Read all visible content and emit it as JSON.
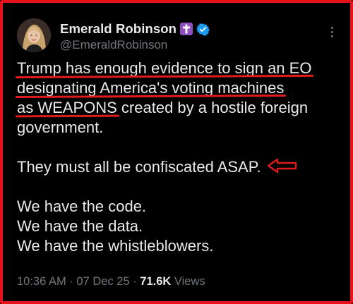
{
  "author": {
    "display_name": "Emerald Robinson",
    "handle": "@EmeraldRobinson",
    "badge_icon": "latin-cross-icon",
    "badge_color": "#8e4fc2",
    "verified_color": "#1d9bf0"
  },
  "tweet": {
    "lines": [
      "Trump has enough evidence to sign an EO",
      "designating America's voting machines",
      "as WEAPONS",
      " created by a hostile foreign",
      "government.",
      "They must all be confiscated ASAP.",
      "We have the code.",
      "We have the data.",
      "We have the whistleblowers."
    ],
    "annotation_color": "#e11b1b"
  },
  "meta": {
    "time": "10:36 AM",
    "sep1": " · ",
    "date": "07 Dec 25",
    "sep2": " · ",
    "views_count": "71.6K",
    "views_label": " Views"
  },
  "colors": {
    "background": "#000000",
    "frame_border": "#e8121a",
    "text_primary": "#e7e9ea",
    "text_secondary": "#71767b"
  }
}
